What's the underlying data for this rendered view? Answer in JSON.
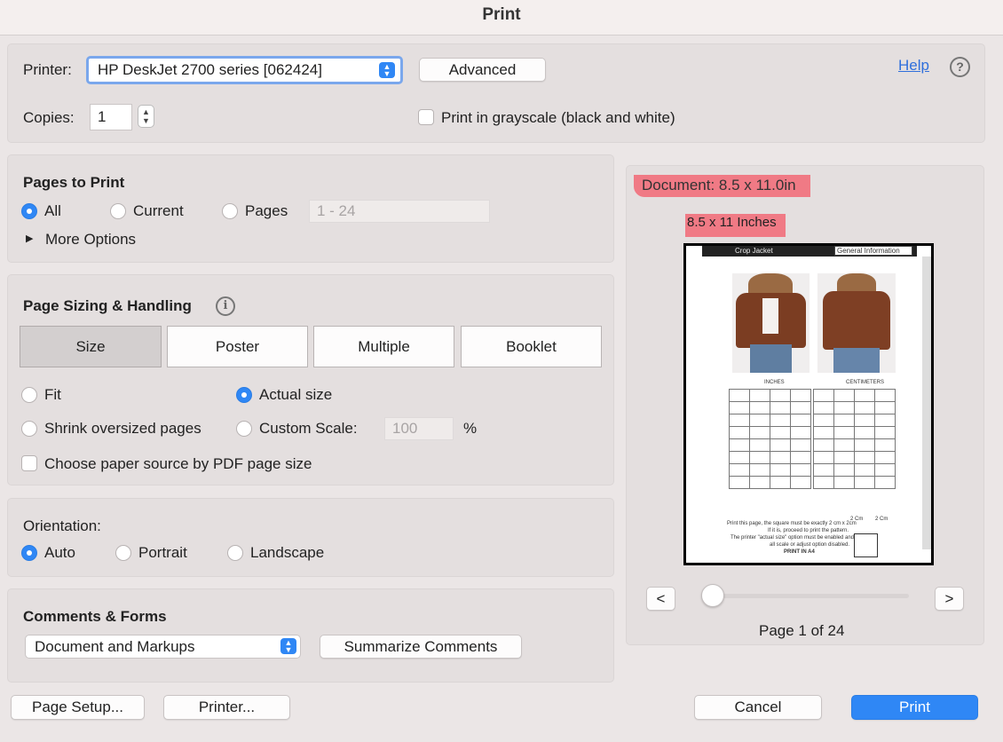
{
  "window": {
    "title": "Print"
  },
  "printer": {
    "label": "Printer:",
    "selected": "HP DeskJet 2700 series [062424]",
    "advanced_label": "Advanced",
    "help_label": "Help",
    "help_icon": "question-mark-icon",
    "copies_label": "Copies:",
    "copies_value": "1",
    "grayscale_label": "Print in grayscale (black and white)",
    "grayscale_checked": false
  },
  "pages_to_print": {
    "title": "Pages to Print",
    "options": [
      "All",
      "Current",
      "Pages"
    ],
    "selected": "All",
    "range_placeholder": "1 - 24",
    "more_options_label": "More Options"
  },
  "sizing": {
    "title": "Page Sizing & Handling",
    "info_icon": "info-icon",
    "tabs": [
      "Size",
      "Poster",
      "Multiple",
      "Booklet"
    ],
    "selected_tab": "Size",
    "fit_label": "Fit",
    "actual_label": "Actual size",
    "shrink_label": "Shrink oversized pages",
    "custom_label": "Custom Scale:",
    "custom_value": "100",
    "percent": "%",
    "selected": "Actual size",
    "paper_source_label": "Choose paper source by PDF page size"
  },
  "orientation": {
    "title": "Orientation:",
    "options": [
      "Auto",
      "Portrait",
      "Landscape"
    ],
    "selected": "Auto"
  },
  "comments": {
    "title": "Comments & Forms",
    "selected": "Document and Markups",
    "summarize_label": "Summarize Comments"
  },
  "preview": {
    "document_size": "Document: 8.5 x 11.0in",
    "page_size_note": "8.5 x 11 Inches",
    "doc_title": "Crop Jacket",
    "doc_section": "General Information",
    "inches_heading": "INCHES",
    "cm_heading": "CENTIMETERS",
    "print_note_1": "Print this page, the square must be exactly 2 cm x 2cm",
    "print_note_2": "If it is, proceed to print the pattern.",
    "print_note_3": "The printer \"actual size\" option must be enabled and",
    "print_note_4": "all scale or adjust option disabled.",
    "print_note_5": "PRINT IN A4",
    "square_label_1": "2 Cm",
    "square_label_2": "2 Cm",
    "prev_label": "<",
    "next_label": ">",
    "page_indicator": "Page 1 of 24",
    "slider_position": 0
  },
  "footer": {
    "page_setup_label": "Page Setup...",
    "printer_label": "Printer...",
    "cancel_label": "Cancel",
    "print_label": "Print"
  },
  "colors": {
    "accent": "#2f87f5",
    "highlight": "#f07a85",
    "background": "#ebe6e6",
    "panel": "#e4dfdf"
  }
}
